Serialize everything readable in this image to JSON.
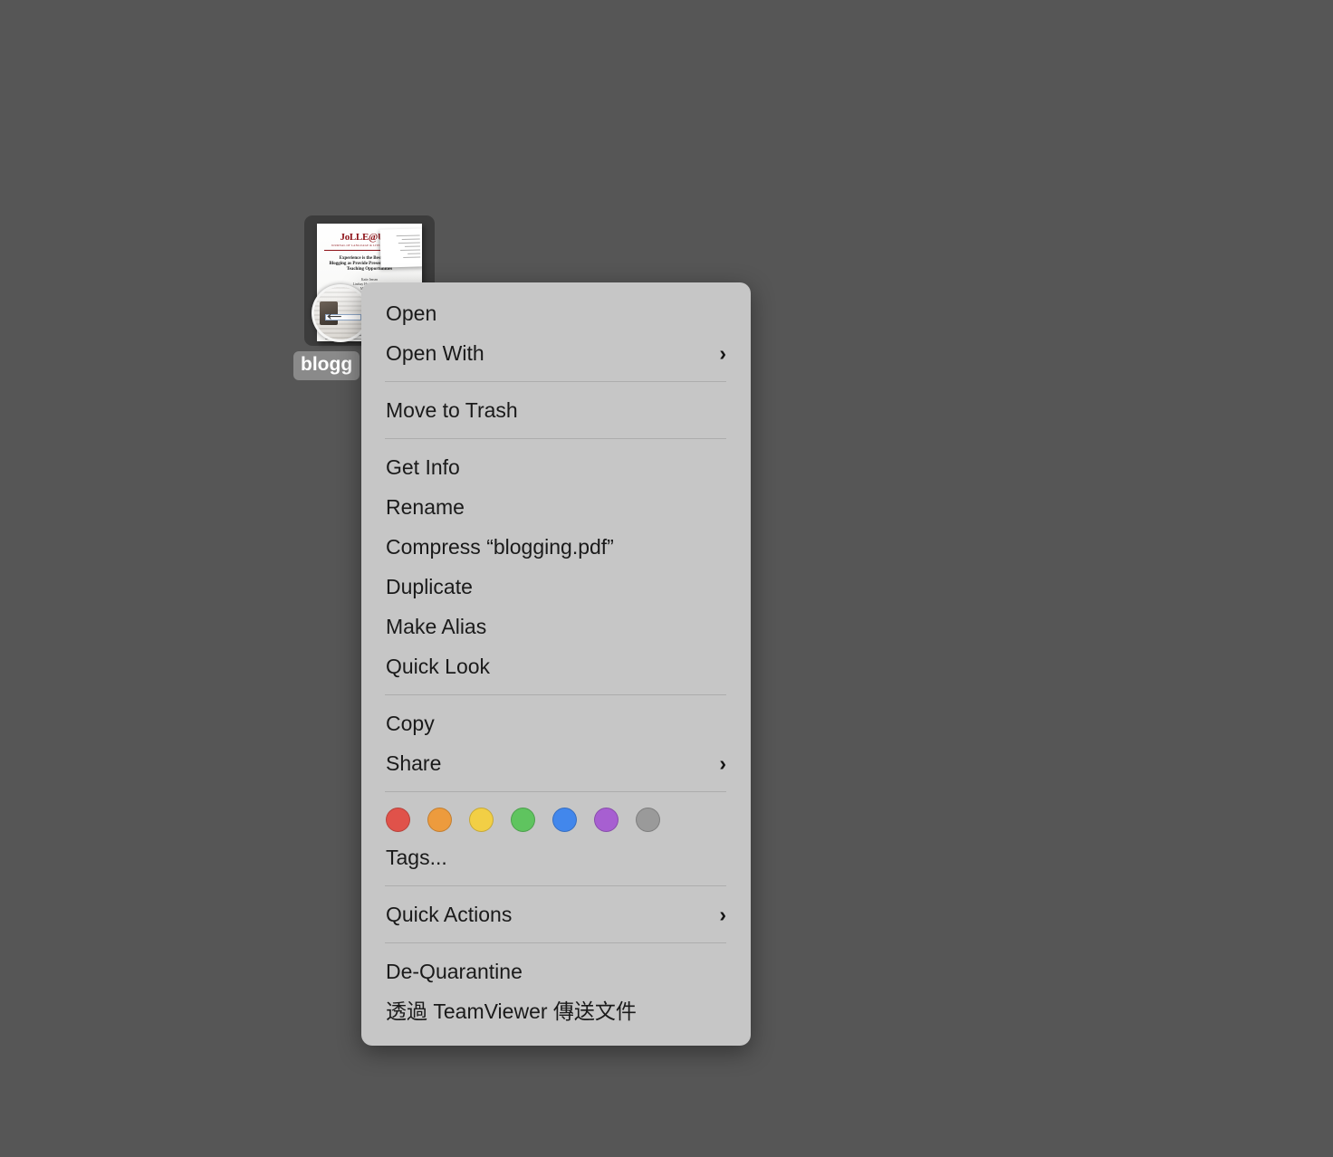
{
  "desktop": {
    "background_color": "#565656",
    "icon": {
      "name": "desktop-file-icon",
      "label": "blogg",
      "full_filename": "blogging.pdf",
      "selected": true,
      "thumbnail": {
        "masthead": "JoLLE@UGA",
        "masthead_sub": "JOURNAL OF LANGUAGE & LITERACY EDUCATION",
        "title_line1": "Experience is the Best Teacher:",
        "title_line2": "Blogging as Provide Preservice Educators",
        "title_line3": "Teaching Opportunities",
        "author1": "Katie Jensen",
        "author2": "Lindsay Hartsuelle Smith",
        "author3": "Martha Harris"
      },
      "badge": "back-arrow-magnifier"
    }
  },
  "context_menu": {
    "background_color": "#c6c6c6",
    "sections": [
      {
        "items": [
          {
            "label": "Open",
            "submenu": false
          },
          {
            "label": "Open With",
            "submenu": true
          }
        ]
      },
      {
        "items": [
          {
            "label": "Move to Trash",
            "submenu": false
          }
        ]
      },
      {
        "items": [
          {
            "label": "Get Info",
            "submenu": false
          },
          {
            "label": "Rename",
            "submenu": false
          },
          {
            "label": "Compress “blogging.pdf”",
            "submenu": false
          },
          {
            "label": "Duplicate",
            "submenu": false
          },
          {
            "label": "Make Alias",
            "submenu": false
          },
          {
            "label": "Quick Look",
            "submenu": false
          }
        ]
      },
      {
        "items": [
          {
            "label": "Copy",
            "submenu": false
          },
          {
            "label": "Share",
            "submenu": true
          }
        ]
      },
      {
        "tags": {
          "colors": [
            {
              "name": "red",
              "hex": "#e0524a"
            },
            {
              "name": "orange",
              "hex": "#ed9b3d"
            },
            {
              "name": "yellow",
              "hex": "#f2cf45"
            },
            {
              "name": "green",
              "hex": "#5fc martha"
            },
            {
              "name": "blue",
              "hex": "#4287ec"
            },
            {
              "name": "purple",
              "hex": "#a75fd1"
            },
            {
              "name": "gray",
              "hex": "#9a9a9a"
            }
          ],
          "label": "Tags..."
        }
      },
      {
        "items": [
          {
            "label": "Quick Actions",
            "submenu": true
          }
        ]
      },
      {
        "items": [
          {
            "label": "De-Quarantine",
            "submenu": false
          },
          {
            "label": "透過 TeamViewer 傳送文件",
            "submenu": false
          }
        ]
      }
    ],
    "chevron_glyph": "›"
  }
}
